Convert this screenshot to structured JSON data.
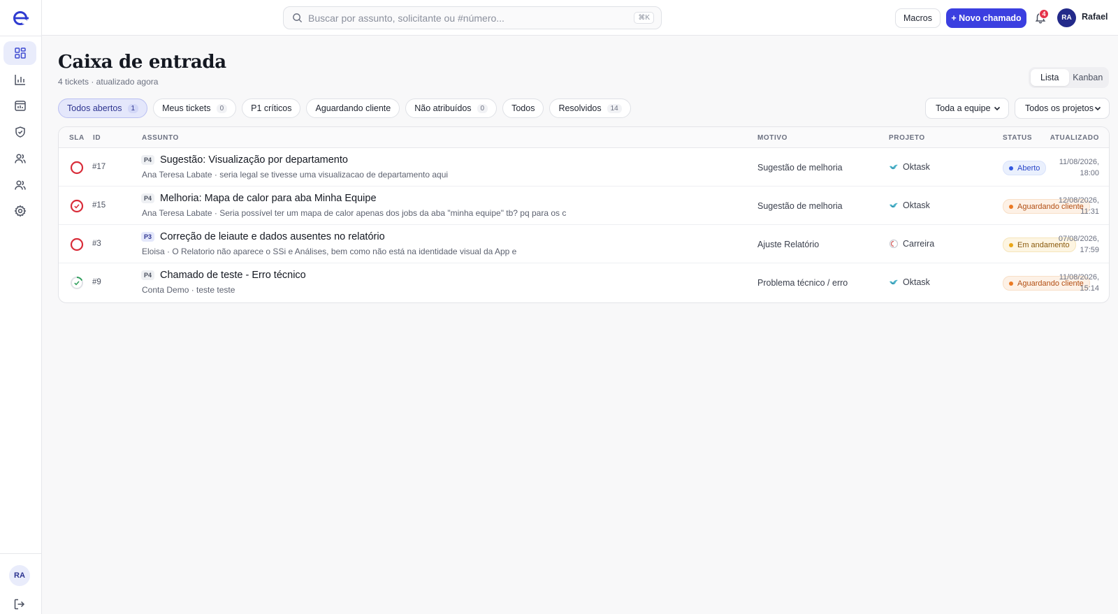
{
  "app": {
    "search_placeholder": "Buscar por assunto, solicitante ou #número...",
    "search_shortcut": "⌘K",
    "macros_label": "Macros",
    "new_ticket_label": "+ Novo chamado",
    "notifications_count": "4",
    "user_initials": "RA",
    "user_name": "Rafael",
    "accent_color": "#3b3fe0"
  },
  "sidebar": {
    "items": [
      {
        "icon": "grid-icon",
        "active": true
      },
      {
        "icon": "bar-chart-icon"
      },
      {
        "icon": "calendar-chart-icon"
      },
      {
        "icon": "shield-check-icon"
      },
      {
        "icon": "users-icon"
      },
      {
        "icon": "team-icon"
      },
      {
        "icon": "gear-icon"
      }
    ],
    "avatar_initials": "RA"
  },
  "header": {
    "title": "Caixa de entrada",
    "subtitle": "4 tickets · atualizado agora",
    "view_list": "Lista",
    "view_kanban": "Kanban"
  },
  "filters": [
    {
      "label": "Todos abertos",
      "count": "1",
      "active": true
    },
    {
      "label": "Meus tickets",
      "count": "0"
    },
    {
      "label": "P1 críticos",
      "count": ""
    },
    {
      "label": "Aguardando cliente",
      "count": ""
    },
    {
      "label": "Não atribuídos",
      "count": "0"
    },
    {
      "label": "Todos",
      "count": ""
    },
    {
      "label": "Resolvidos",
      "count": "14"
    }
  ],
  "selects": {
    "team": "Toda a equipe",
    "projects": "Todos os projetos"
  },
  "table": {
    "columns": [
      "SLA",
      "ID",
      "ASSUNTO",
      "MOTIVO",
      "PROJETO",
      "STATUS",
      "ATUALIZADO"
    ],
    "rows": [
      {
        "sla": "breached",
        "id": "#17",
        "priority": "P4",
        "subject": "Sugestão: Visualização por departamento",
        "preview": "Ana Teresa Labate · seria legal se tivesse uma visualizacao de departamento aqui",
        "motivo": "Sugestão de melhoria",
        "project": "Oktask",
        "project_icon": "bird",
        "status": "Aberto",
        "status_kind": "open",
        "updated_date": "11/08/2026,",
        "updated_time": "18:00"
      },
      {
        "sla": "breached-check",
        "id": "#15",
        "priority": "P4",
        "subject": "Melhoria: Mapa de calor para aba Minha Equipe",
        "preview": "Ana Teresa Labate · Seria possível ter um mapa de calor apenas dos jobs da aba \"minha equipe\" tb? pq para os c",
        "motivo": "Sugestão de melhoria",
        "project": "Oktask",
        "project_icon": "bird",
        "status": "Aguardando cliente",
        "status_kind": "wait",
        "updated_date": "12/08/2026,",
        "updated_time": "11:31"
      },
      {
        "sla": "breached",
        "id": "#3",
        "priority": "P3",
        "subject": "Correção de leiaute e dados ausentes no relatório",
        "preview": "Eloisa · O Relatorio não aparece o SSi e Análises, bem como não está na identidade visual da App e",
        "motivo": "Ajuste Relatório",
        "project": "Carreira",
        "project_icon": "circle",
        "status": "Em andamento",
        "status_kind": "prog",
        "updated_date": "07/08/2026,",
        "updated_time": "17:59"
      },
      {
        "sla": "ok",
        "id": "#9",
        "priority": "P4",
        "subject": "Chamado de teste - Erro técnico",
        "preview": "Conta Demo · teste teste",
        "motivo": "Problema técnico / erro",
        "project": "Oktask",
        "project_icon": "bird",
        "status": "Aguardando cliente",
        "status_kind": "wait",
        "updated_date": "11/08/2026,",
        "updated_time": "15:14"
      }
    ]
  }
}
